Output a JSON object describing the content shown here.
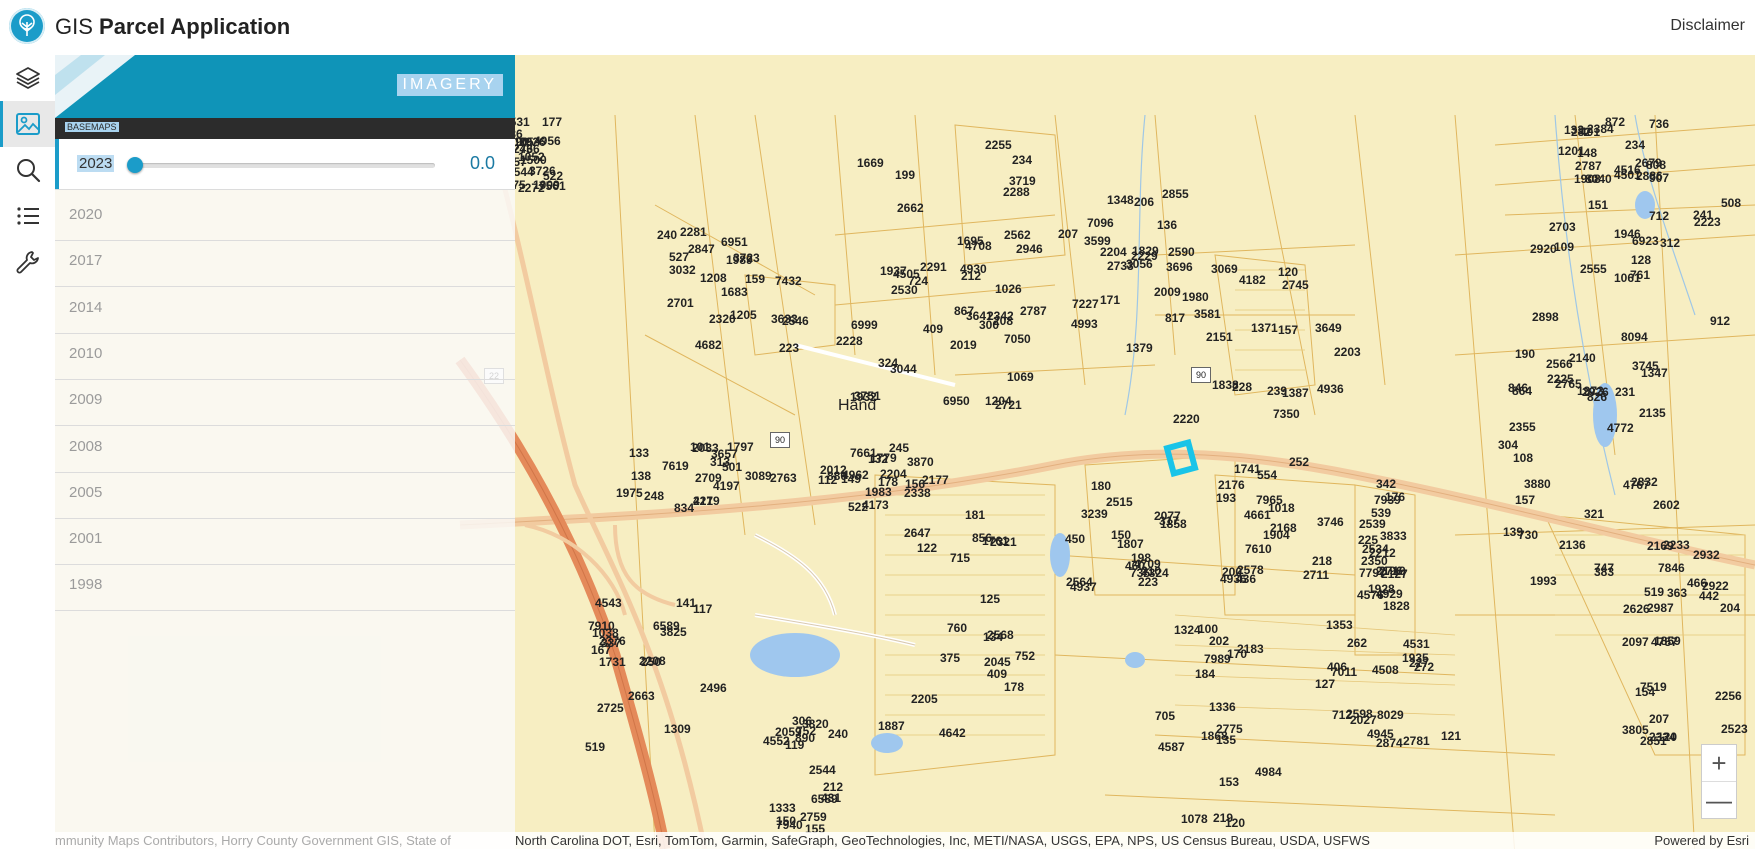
{
  "header": {
    "title_prefix": "GIS ",
    "title_bold": "Parcel Application",
    "disclaimer": "Disclaimer"
  },
  "toolbar": {
    "items": [
      {
        "name": "layers-icon"
      },
      {
        "name": "image-icon"
      },
      {
        "name": "search-icon"
      },
      {
        "name": "list-icon"
      },
      {
        "name": "wrench-icon"
      }
    ]
  },
  "panel": {
    "title": "IMAGERY",
    "section_label": "BASEMAPS",
    "selected_year": "2023",
    "slider_value": "0.0",
    "slider_fraction": 0.0,
    "years": [
      "2020",
      "2017",
      "2014",
      "2010",
      "2009",
      "2008",
      "2005",
      "2001",
      "1998"
    ]
  },
  "map": {
    "place_label": "Hand",
    "highway_shields": [
      "22",
      "90",
      "90"
    ],
    "parcels": [
      "1500",
      "1669",
      "1683",
      "1932",
      "1829",
      "1838",
      "1797",
      "1779",
      "1761",
      "1807",
      "1741",
      "1828",
      "1731",
      "1887",
      "1868",
      "1935",
      "1908",
      "1946",
      "1973",
      "1993",
      "1859",
      "1875",
      "1937",
      "1989",
      "2019",
      "2009",
      "1980",
      "2033",
      "2012",
      "2045",
      "1858",
      "1904",
      "1928",
      "2208",
      "2059",
      "2183",
      "2027",
      "907",
      "912",
      "4772",
      "4767",
      "4757",
      "4743",
      "4708",
      "4682",
      "2228",
      "2229",
      "2220",
      "2219",
      "2204",
      "2205",
      "2077",
      "2176",
      "2196",
      "1309",
      "1333",
      "1324",
      "1353",
      "4516",
      "2223",
      "2140",
      "2136",
      "2097",
      "2105",
      "2255",
      "2281",
      "867",
      "1348",
      "1371",
      "1975",
      "1983",
      "4642",
      "4709",
      "4661",
      "4576",
      "4543",
      "4552",
      "4587",
      "4508",
      "4501",
      "128",
      "108",
      "2169",
      "2256",
      "2272",
      "2288",
      "1205",
      "1204",
      "1379",
      "1387",
      "101",
      "2177",
      "125",
      "223",
      "2168",
      "2127",
      "167",
      "155",
      "170",
      "4531",
      "148",
      "151",
      "2135",
      "139",
      "154",
      "4544",
      "4505",
      "159",
      "208",
      "2204",
      "2203",
      "133",
      "132",
      "760",
      "180",
      "200",
      "2212",
      "117",
      "752",
      "100",
      "712",
      "736",
      "6923",
      "2225",
      "2233",
      "7519",
      "7561",
      "724",
      "7432",
      "6999",
      "7227",
      "7350",
      "7619",
      "7661",
      "752",
      "7324",
      "7610",
      "7797",
      "2496",
      "119",
      "135",
      "7011",
      "808",
      "761",
      "826",
      "157",
      "120",
      "1009",
      "2291",
      "6951",
      "7050",
      "7096",
      "817",
      "834",
      "156",
      "181",
      "2515",
      "1018",
      "2534",
      "6589",
      "212",
      "202",
      "127",
      "872",
      "712",
      "846",
      "747",
      "2523",
      "2531",
      "1026",
      "2546",
      "6950",
      "207",
      "120",
      "501",
      "522",
      "856",
      "735",
      "193",
      "2539",
      "1038",
      "2544",
      "219",
      "406",
      "133",
      "109",
      "864",
      "730",
      "207",
      "1052",
      "2562",
      "2320",
      "409",
      "136",
      "157",
      "417",
      "880",
      "715",
      "210",
      "2578",
      "225",
      "141",
      "890",
      "705",
      "227",
      "1201",
      "1061",
      "304",
      "383",
      "442",
      "522",
      "234",
      "1208",
      "1069",
      "2590",
      "228",
      "248",
      "178",
      "375",
      "450",
      "554",
      "539",
      "519",
      "240",
      "1078",
      "2598",
      "234",
      "241",
      "190",
      "363",
      "466",
      "1236",
      "2530",
      "240",
      "324",
      "206",
      "2151",
      "138",
      "112",
      "409",
      "317",
      "218",
      "342",
      "337",
      "6589",
      "153",
      "121",
      "401",
      "312",
      "231",
      "321",
      "2334",
      "177",
      "199",
      "223",
      "300",
      "171",
      "239",
      "313",
      "2338",
      "178",
      "198",
      "4936",
      "176",
      "250",
      "306",
      "184",
      "262",
      "282",
      "2555",
      "2566",
      "2602",
      "2626",
      "2657",
      "2662",
      "2701",
      "2721",
      "2733",
      "2745",
      "2763",
      "4962",
      "2647",
      "460",
      "436",
      "4929",
      "2663",
      "431",
      "4984",
      "4945",
      "2679",
      "508",
      "2355",
      "204",
      "519",
      "4956",
      "212",
      "527",
      "2342",
      "4993",
      "4936",
      "2709",
      "245",
      "2321",
      "4937",
      "252",
      "2350",
      "2376",
      "2759",
      "2775",
      "272",
      "2384",
      "2703",
      "2765",
      "2832",
      "2851",
      "2766",
      "4930",
      "2847",
      "2787",
      "2855",
      "4182",
      "4197",
      "4173",
      "122",
      "150",
      "2711",
      "2719",
      "2725",
      "150",
      "120",
      "2781",
      "2787",
      "2920",
      "2926",
      "2932",
      "2987",
      "3690",
      "1695",
      "3633",
      "3641",
      "3696",
      "3649",
      "3657",
      "3870",
      "2568",
      "2564",
      "3746",
      "3833",
      "3825",
      "3820",
      "1336",
      "2874",
      "2886",
      "2898",
      "1347",
      "3880",
      "2922",
      "2926",
      "2946",
      "3032",
      "3044",
      "3056",
      "3069",
      "3089",
      "149",
      "134",
      "3239",
      "7965",
      "7939",
      "7910",
      "7940",
      "7989",
      "8029",
      "8040",
      "8094",
      "3745",
      "7846",
      "3805",
      "3726",
      "3719",
      "3723",
      "3751",
      "3599",
      "3581"
    ]
  },
  "zoom": {
    "in": "+",
    "out": "—"
  },
  "attribution": {
    "left": "mmunity Maps Contributors, Horry County Government GIS, State of",
    "main": "North Carolina DOT, Esri, TomTom, Garmin, SafeGraph, GeoTechnologies, Inc, METI/NASA, USGS, EPA, NPS, US Census Bureau, USDA, USFWS",
    "right": "Powered by Esri"
  }
}
